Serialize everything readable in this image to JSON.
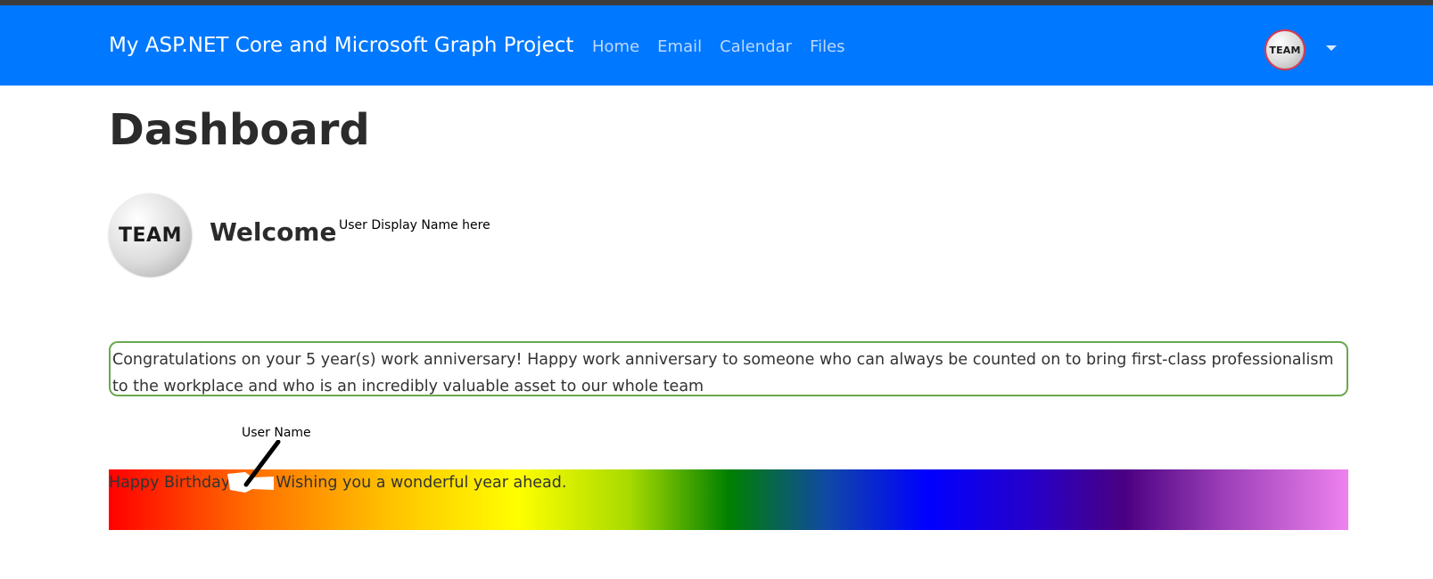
{
  "navbar": {
    "brand": "My ASP.NET Core and Microsoft Graph Project",
    "links": [
      "Home",
      "Email",
      "Calendar",
      "Files"
    ],
    "avatar_text": "TEAM"
  },
  "page": {
    "title": "Dashboard",
    "avatar_text": "TEAM",
    "welcome": "Welcome",
    "display_name_annotation": "User Display Name here"
  },
  "anniversary": {
    "message": "Congratulations on your 5 year(s) work anniversary! Happy work anniversary to someone who can always be counted on to bring first-class professionalism to the workplace and who is an incredibly valuable asset to our whole team"
  },
  "birthday": {
    "user_annotation": "User Name",
    "prefix": "Happy Birthday",
    "suffix": "Wishing you a wonderful year ahead."
  },
  "colors": {
    "navbar_bg": "#0078ff",
    "nav_link": "#bcd9ff",
    "anniversary_border": "#6aa84f",
    "avatar_border": "#d63b52"
  }
}
